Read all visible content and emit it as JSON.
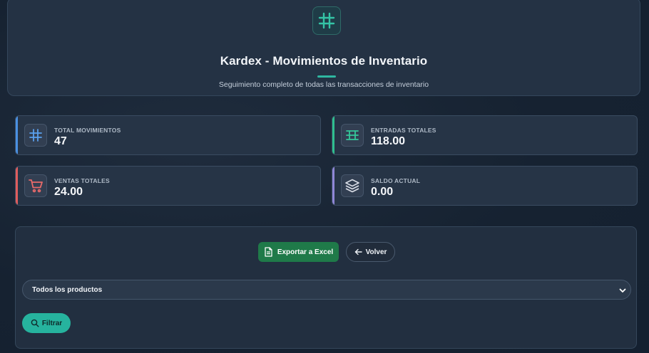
{
  "header": {
    "icon": "grid-hash-icon",
    "title": "Kardex - Movimientos de Inventario",
    "subtitle": "Seguimiento completo de todas las transacciones de inventario"
  },
  "stats": [
    {
      "label": "TOTAL MOVIMIENTOS",
      "value": "47",
      "icon": "grid-hash-icon",
      "accent": "#4a90e2"
    },
    {
      "label": "ENTRADAS TOTALES",
      "value": "118.00",
      "icon": "table-rows-icon",
      "accent": "#2fbf8f"
    },
    {
      "label": "VENTAS TOTALES",
      "value": "24.00",
      "icon": "shopping-cart-icon",
      "accent": "#e05d5d"
    },
    {
      "label": "SALDO ACTUAL",
      "value": "0.00",
      "icon": "layers-stack-icon",
      "accent": "#8f86d6"
    }
  ],
  "actions": {
    "export_label": "Exportar a Excel",
    "back_label": "Volver"
  },
  "filter": {
    "product_selected": "Todos los productos",
    "filter_label": "Filtrar"
  },
  "colors": {
    "teal": "#2fb7a1",
    "excel_green": "#1f7a49"
  }
}
